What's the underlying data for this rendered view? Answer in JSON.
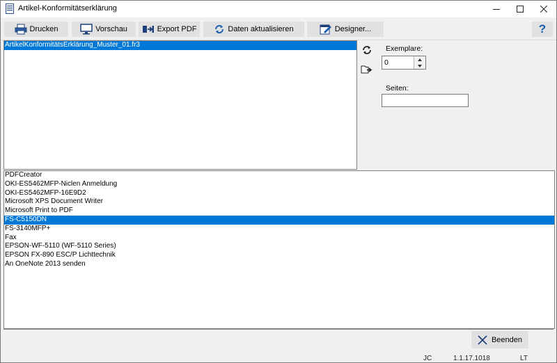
{
  "window": {
    "title": "Artikel-Konformitätserklärung",
    "icons": {
      "app": "document-icon",
      "minimize": "minimize-icon",
      "maximize": "maximize-icon",
      "close": "close-icon"
    }
  },
  "toolbar": {
    "print_label": "Drucken",
    "preview_label": "Vorschau",
    "export_pdf_label": "Export PDF",
    "refresh_data_label": "Daten aktualisieren",
    "designer_label": "Designer...",
    "help_label": "?"
  },
  "reports": {
    "items": [
      {
        "label": "ArtikelKonformitätsErklärung_Muster_01.fr3",
        "selected": true
      }
    ]
  },
  "side": {
    "refresh_icon": "refresh-icon",
    "open_file_icon": "folder-arrow-icon",
    "copies_label": "Exemplare:",
    "copies_value": "0",
    "pages_label": "Seiten:",
    "pages_value": ""
  },
  "printers": {
    "items": [
      {
        "label": "PDFCreator",
        "selected": false
      },
      {
        "label": "OKI-ES5462MFP-Niclen Anmeldung",
        "selected": false
      },
      {
        "label": "OKI-ES5462MFP-16E9D2",
        "selected": false
      },
      {
        "label": "Microsoft XPS Document Writer",
        "selected": false
      },
      {
        "label": "Microsoft Print to PDF",
        "selected": false
      },
      {
        "label": "FS-C5150DN",
        "selected": true
      },
      {
        "label": "FS-3140MFP+",
        "selected": false
      },
      {
        "label": "Fax",
        "selected": false
      },
      {
        "label": "EPSON-WF-5110 (WF-5110 Series)",
        "selected": false
      },
      {
        "label": "EPSON FX-890 ESC/P Lichttechnik",
        "selected": false
      },
      {
        "label": "An OneNote 2013 senden",
        "selected": false
      }
    ]
  },
  "footer": {
    "close_label": "Beenden",
    "status_user": "JC",
    "status_version": "1.1.17.1018",
    "status_lang": "LT"
  },
  "colors": {
    "selection": "#0078d7",
    "accent_icon": "#1c5fae"
  }
}
